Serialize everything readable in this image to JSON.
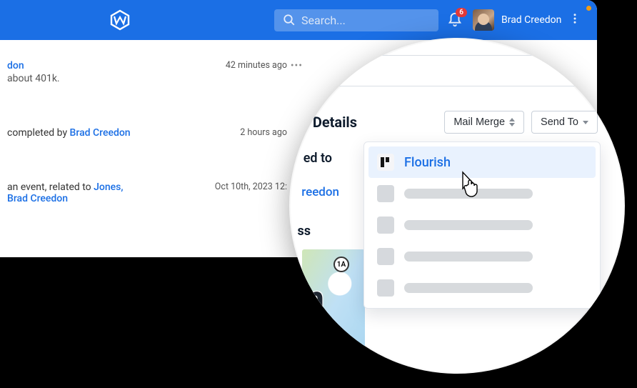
{
  "header": {
    "search_placeholder": "Search...",
    "notification_count": "6",
    "username": "Brad Creedon"
  },
  "feed": {
    "item1": {
      "title_fragment": "don",
      "subtitle": "about 401k.",
      "time": "42 minutes ago"
    },
    "item2": {
      "completed_prefix": "completed by ",
      "completed_name": "Brad Creedon",
      "time": "2 hours ago"
    },
    "item3": {
      "prefix": "an event, related to ",
      "link1": "Jones,",
      "line2_name": "Brad Creedon",
      "time": "Oct 10th, 2023 12:"
    }
  },
  "lens": {
    "title": "act Details",
    "mail_merge_label": "Mail Merge",
    "send_to_label": "Send To",
    "assigned_frag": "ed to",
    "creedon_frag": "reedon",
    "ss_frag": "ss",
    "map_route": "1A",
    "map_big_letters": "n",
    "dropdown": {
      "flourish": "Flourish"
    }
  }
}
